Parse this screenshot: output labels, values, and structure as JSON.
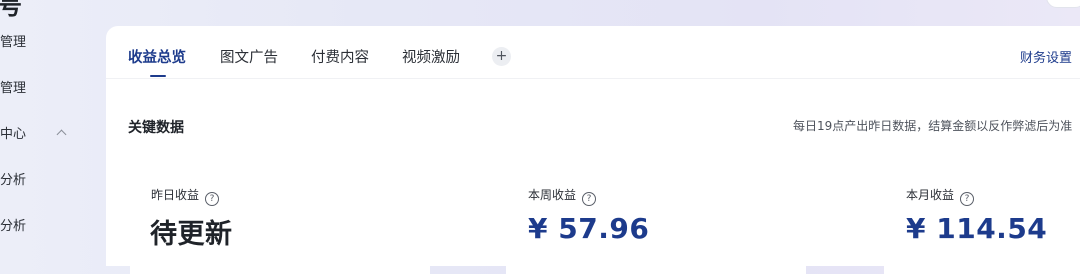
{
  "top": {
    "logo_fragment": "号"
  },
  "sidebar": {
    "items": [
      {
        "label": "管理"
      },
      {
        "label": "管理"
      },
      {
        "label": "中心"
      },
      {
        "label": "分析"
      },
      {
        "label": "分析"
      }
    ]
  },
  "tabs": [
    {
      "label": "收益总览",
      "active": true
    },
    {
      "label": "图文广告"
    },
    {
      "label": "付费内容"
    },
    {
      "label": "视频激励"
    }
  ],
  "add_tab_label": "+",
  "finance_settings": "财务设置",
  "key_data": {
    "title": "关键数据",
    "note": "每日19点产出昨日数据，结算金额以反作弊滤后为准"
  },
  "metrics": [
    {
      "label": "昨日收益",
      "value": "待更新"
    },
    {
      "label": "本周收益",
      "value": "¥ 57.96"
    },
    {
      "label": "本月收益",
      "value": "¥ 114.54"
    }
  ],
  "help_icon_glyph": "?",
  "colors": {
    "accent": "#1d3b8c",
    "text": "#1f2329",
    "panel": "#ffffff"
  }
}
